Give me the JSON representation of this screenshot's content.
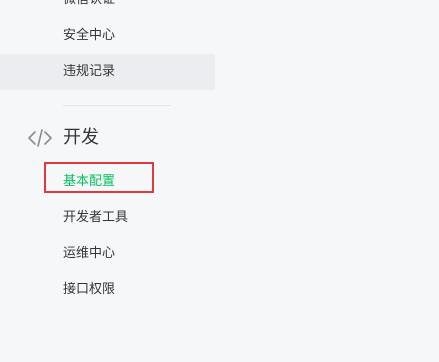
{
  "sidebar": {
    "top_items": [
      {
        "label": "微信认证"
      },
      {
        "label": "安全中心"
      },
      {
        "label": "违规记录"
      }
    ],
    "dev_group": {
      "title": "开发",
      "icon": "code-icon",
      "items": [
        {
          "label": "基本配置"
        },
        {
          "label": "开发者工具"
        },
        {
          "label": "运维中心"
        },
        {
          "label": "接口权限"
        }
      ]
    }
  },
  "colors": {
    "active_text": "#07c160",
    "highlight_border": "#e0393e",
    "selected_bg": "#ebedf0",
    "page_bg": "#f6f7f9"
  }
}
